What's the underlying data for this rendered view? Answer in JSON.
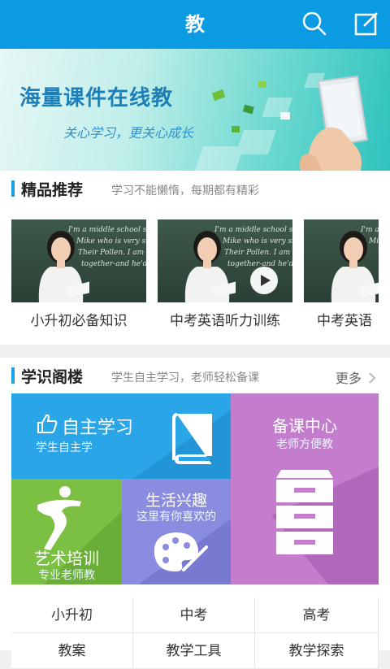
{
  "header": {
    "title": "教",
    "search_icon": "search-icon",
    "edit_icon": "edit-icon"
  },
  "banner": {
    "main_text": "海量课件在线教",
    "sub_text": "关心学习，更关心成长"
  },
  "recommend": {
    "title": "精品推荐",
    "subtitle": "学习不能懒惰，每期都有精彩",
    "items": [
      {
        "label": "小升初必备知识"
      },
      {
        "label": "中考英语听力训练"
      },
      {
        "label": "中考英语"
      }
    ]
  },
  "study": {
    "title": "学识阁楼",
    "subtitle": "学生自主学习，老师轻松备课",
    "more": "更多",
    "tiles": {
      "self": {
        "title": "自主学习",
        "subtitle": "学生自主学",
        "color": "#2aa5e8"
      },
      "prep": {
        "title": "备课中心",
        "subtitle": "老师方便教",
        "color": "#c47dcc"
      },
      "art": {
        "title": "艺术培训",
        "subtitle": "专业老师教",
        "color": "#7cc043"
      },
      "life": {
        "title": "生活兴趣",
        "subtitle": "这里有你喜欢的",
        "color": "#8a8ce0"
      }
    },
    "grid": [
      "小升初",
      "中考",
      "高考",
      "教案",
      "教学工具",
      "教学探索"
    ]
  }
}
